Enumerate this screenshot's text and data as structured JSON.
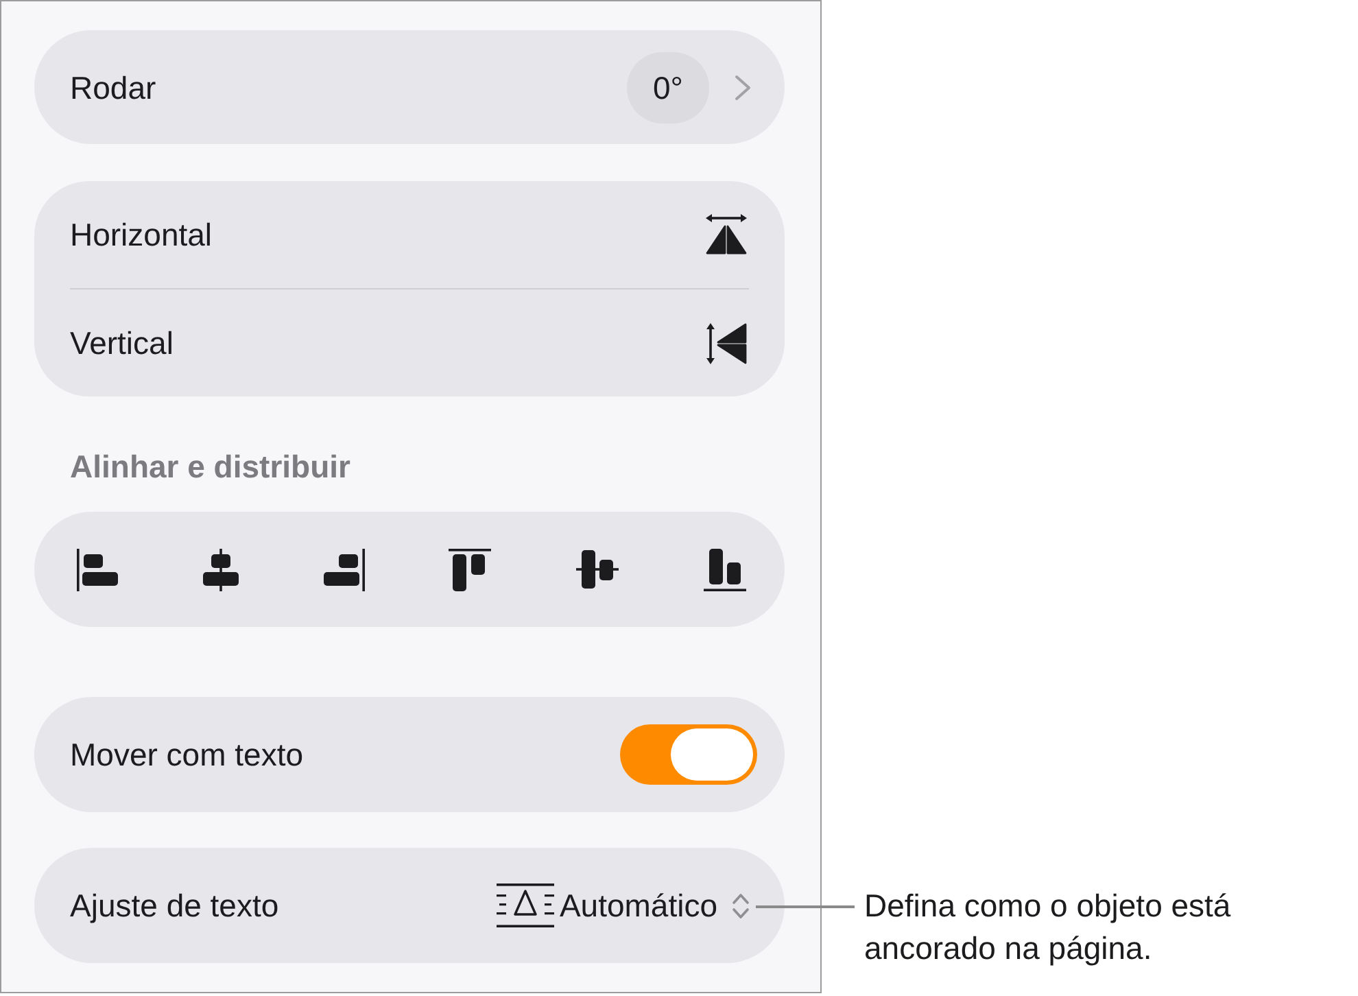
{
  "rotate": {
    "label": "Rodar",
    "value": "0°"
  },
  "flip": [
    {
      "label": "Horizontal",
      "kind": "horizontal"
    },
    {
      "label": "Vertical",
      "kind": "vertical"
    }
  ],
  "align_section": {
    "title": "Alinhar e distribuir"
  },
  "move_with_text": {
    "label": "Mover com texto",
    "on": true
  },
  "text_wrap": {
    "label": "Ajuste de texto",
    "value": "Automático"
  },
  "callout": {
    "text": "Defina como o objeto está ancorado na página."
  }
}
